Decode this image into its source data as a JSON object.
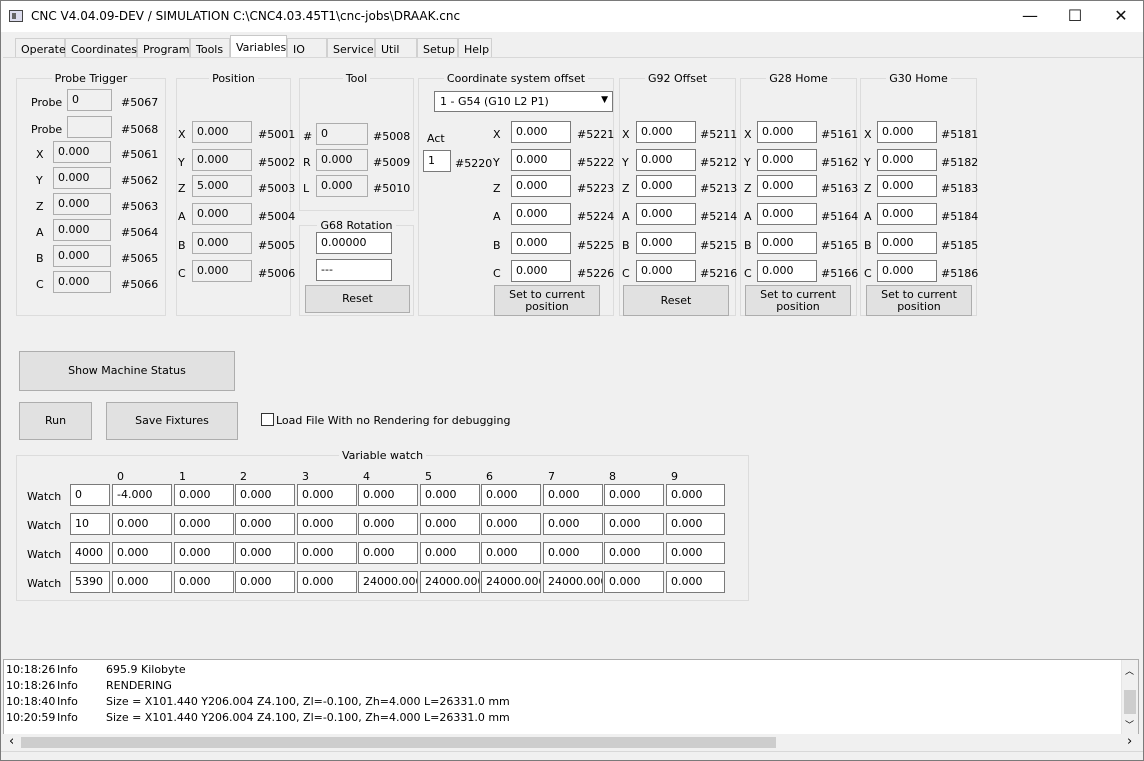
{
  "window": {
    "title": "CNC V4.04.09-DEV / SIMULATION",
    "path": "C:\\CNC4.03.45T1\\cnc-jobs\\DRAAK.cnc",
    "minimize": "—",
    "maximize": "☐",
    "close": "✕"
  },
  "tabs": [
    "Operate",
    "Coordinates",
    "Program",
    "Tools",
    "Variables",
    "IO",
    "Service",
    "Util",
    "Setup",
    "Help"
  ],
  "probe": {
    "title": "Probe Trigger",
    "rows": [
      {
        "label": "Probe",
        "value": "0",
        "var": "#5067"
      },
      {
        "label": "Probe",
        "value": "",
        "var": "#5068"
      },
      {
        "label": "X",
        "value": "0.000",
        "var": "#5061"
      },
      {
        "label": "Y",
        "value": "0.000",
        "var": "#5062"
      },
      {
        "label": "Z",
        "value": "0.000",
        "var": "#5063"
      },
      {
        "label": "A",
        "value": "0.000",
        "var": "#5064"
      },
      {
        "label": "B",
        "value": "0.000",
        "var": "#5065"
      },
      {
        "label": "C",
        "value": "0.000",
        "var": "#5066"
      }
    ]
  },
  "position": {
    "title": "Position",
    "rows": [
      {
        "label": "X",
        "value": "0.000",
        "var": "#5001"
      },
      {
        "label": "Y",
        "value": "0.000",
        "var": "#5002"
      },
      {
        "label": "Z",
        "value": "5.000",
        "var": "#5003"
      },
      {
        "label": "A",
        "value": "0.000",
        "var": "#5004"
      },
      {
        "label": "B",
        "value": "0.000",
        "var": "#5005"
      },
      {
        "label": "C",
        "value": "0.000",
        "var": "#5006"
      }
    ]
  },
  "tool": {
    "title": "Tool",
    "rows": [
      {
        "label": "#",
        "value": "0",
        "var": "#5008"
      },
      {
        "label": "R",
        "value": "0.000",
        "var": "#5009"
      },
      {
        "label": "L",
        "value": "0.000",
        "var": "#5010"
      }
    ]
  },
  "g68": {
    "title": "G68 Rotation",
    "angle": "0.00000",
    "mode": "---",
    "reset": "Reset"
  },
  "cso": {
    "title": "Coordinate system offset",
    "selected": "1 - G54   (G10 L2 P1)",
    "act_label": "Act",
    "act_value": "1",
    "act_var": "#5220",
    "rows": [
      {
        "label": "X",
        "value": "0.000",
        "var": "#5221"
      },
      {
        "label": "Y",
        "value": "0.000",
        "var": "#5222"
      },
      {
        "label": "Z",
        "value": "0.000",
        "var": "#5223"
      },
      {
        "label": "A",
        "value": "0.000",
        "var": "#5224"
      },
      {
        "label": "B",
        "value": "0.000",
        "var": "#5225"
      },
      {
        "label": "C",
        "value": "0.000",
        "var": "#5226"
      }
    ],
    "button": "Set to current position"
  },
  "g92": {
    "title": "G92 Offset",
    "rows": [
      {
        "label": "X",
        "value": "0.000",
        "var": "#5211"
      },
      {
        "label": "Y",
        "value": "0.000",
        "var": "#5212"
      },
      {
        "label": "Z",
        "value": "0.000",
        "var": "#5213"
      },
      {
        "label": "A",
        "value": "0.000",
        "var": "#5214"
      },
      {
        "label": "B",
        "value": "0.000",
        "var": "#5215"
      },
      {
        "label": "C",
        "value": "0.000",
        "var": "#5216"
      }
    ],
    "button": "Reset"
  },
  "g28": {
    "title": "G28 Home",
    "rows": [
      {
        "label": "X",
        "value": "0.000",
        "var": "#5161"
      },
      {
        "label": "Y",
        "value": "0.000",
        "var": "#5162"
      },
      {
        "label": "Z",
        "value": "0.000",
        "var": "#5163"
      },
      {
        "label": "A",
        "value": "0.000",
        "var": "#5164"
      },
      {
        "label": "B",
        "value": "0.000",
        "var": "#5165"
      },
      {
        "label": "C",
        "value": "0.000",
        "var": "#5166"
      }
    ],
    "button": "Set to current position"
  },
  "g30": {
    "title": "G30 Home",
    "rows": [
      {
        "label": "X",
        "value": "0.000",
        "var": "#5181"
      },
      {
        "label": "Y",
        "value": "0.000",
        "var": "#5182"
      },
      {
        "label": "Z",
        "value": "0.000",
        "var": "#5183"
      },
      {
        "label": "A",
        "value": "0.000",
        "var": "#5184"
      },
      {
        "label": "B",
        "value": "0.000",
        "var": "#5185"
      },
      {
        "label": "C",
        "value": "0.000",
        "var": "#5186"
      }
    ],
    "button": "Set to current position"
  },
  "actions": {
    "machine_status": "Show Machine Status",
    "run": "Run",
    "save_fixtures": "Save Fixtures",
    "load_no_render": "Load File With no Rendering for debugging"
  },
  "watch": {
    "title": "Variable watch",
    "columns": [
      "0",
      "1",
      "2",
      "3",
      "4",
      "5",
      "6",
      "7",
      "8",
      "9"
    ],
    "row_label": "Watch",
    "rows": [
      {
        "base": "0",
        "values": [
          "-4.000",
          "0.000",
          "0.000",
          "0.000",
          "0.000",
          "0.000",
          "0.000",
          "0.000",
          "0.000",
          "0.000"
        ]
      },
      {
        "base": "10",
        "values": [
          "0.000",
          "0.000",
          "0.000",
          "0.000",
          "0.000",
          "0.000",
          "0.000",
          "0.000",
          "0.000",
          "0.000"
        ]
      },
      {
        "base": "4000",
        "values": [
          "0.000",
          "0.000",
          "0.000",
          "0.000",
          "0.000",
          "0.000",
          "0.000",
          "0.000",
          "0.000",
          "0.000"
        ]
      },
      {
        "base": "5390",
        "values": [
          "0.000",
          "0.000",
          "0.000",
          "0.000",
          "24000.000",
          "24000.000",
          "24000.000",
          "24000.000",
          "0.000",
          "0.000"
        ]
      }
    ]
  },
  "log": [
    {
      "time": "10:18:26",
      "level": "Info",
      "msg": "695.9 Kilobyte"
    },
    {
      "time": "10:18:26",
      "level": "Info",
      "msg": "RENDERING"
    },
    {
      "time": "10:18:40",
      "level": "Info",
      "msg": "Size = X101.440 Y206.004 Z4.100, Zl=-0.100, Zh=4.000 L=26331.0 mm"
    },
    {
      "time": "10:20:59",
      "level": "Info",
      "msg": "Size = X101.440 Y206.004 Z4.100, Zl=-0.100, Zh=4.000 L=26331.0 mm"
    }
  ],
  "scroll": {
    "up": "︿",
    "down": "﹀",
    "left": "‹",
    "right": "›"
  }
}
